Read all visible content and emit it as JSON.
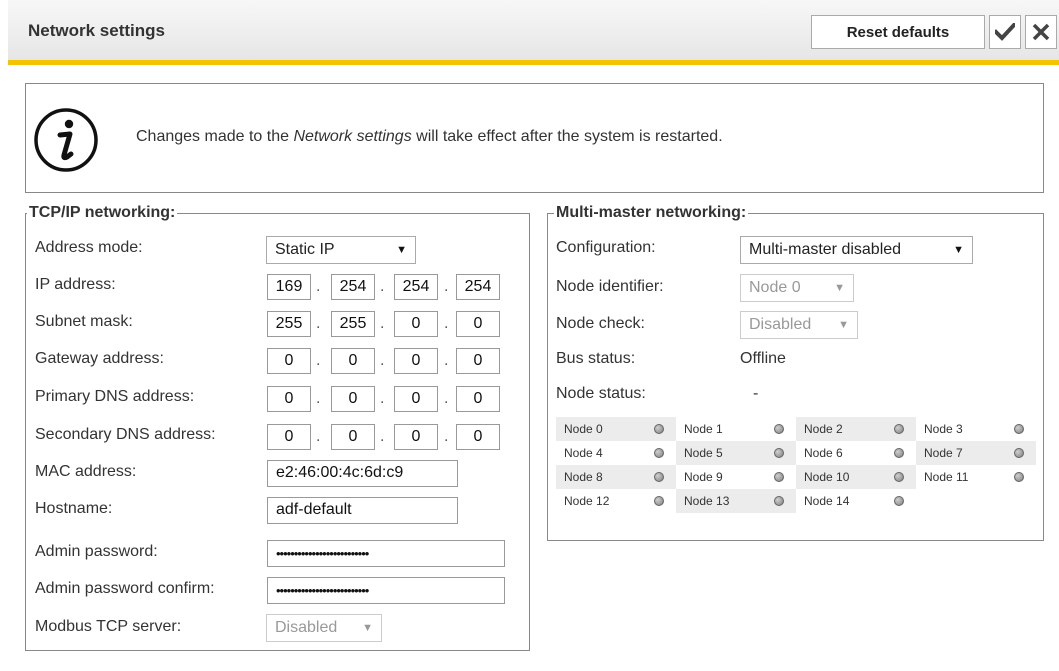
{
  "header": {
    "title": "Network settings",
    "reset_label": "Reset defaults",
    "ok_icon": "check-icon",
    "close_icon": "close-icon",
    "accent_color": "#f5c400"
  },
  "notice": {
    "icon": "info-icon",
    "text_before": "Changes made to the ",
    "text_em": "Network settings",
    "text_after": " will take effect after the system is restarted."
  },
  "tcp": {
    "title": "TCP/IP networking:",
    "address_mode": {
      "label": "Address mode:",
      "value": "Static IP"
    },
    "ip_address": {
      "label": "IP address:",
      "octets": [
        "169",
        "254",
        "254",
        "254"
      ]
    },
    "subnet_mask": {
      "label": "Subnet mask:",
      "octets": [
        "255",
        "255",
        "0",
        "0"
      ]
    },
    "gateway": {
      "label": "Gateway address:",
      "octets": [
        "0",
        "0",
        "0",
        "0"
      ]
    },
    "primary_dns": {
      "label": "Primary DNS address:",
      "octets": [
        "0",
        "0",
        "0",
        "0"
      ]
    },
    "secondary_dns": {
      "label": "Secondary DNS address:",
      "octets": [
        "0",
        "0",
        "0",
        "0"
      ]
    },
    "mac": {
      "label": "MAC address:",
      "value": "e2:46:00:4c:6d:c9"
    },
    "hostname": {
      "label": "Hostname:",
      "value": "adf-default"
    },
    "admin_password": {
      "label": "Admin password:",
      "value": "••••••••••••••••••••••••••"
    },
    "admin_password_confirm": {
      "label": "Admin password confirm:",
      "value": "••••••••••••••••••••••••••"
    },
    "modbus": {
      "label": "Modbus TCP server:",
      "value": "Disabled"
    }
  },
  "mm": {
    "title": "Multi-master networking:",
    "configuration": {
      "label": "Configuration:",
      "value": "Multi-master disabled"
    },
    "node_identifier": {
      "label": "Node identifier:",
      "value": "Node 0"
    },
    "node_check": {
      "label": "Node check:",
      "value": "Disabled"
    },
    "bus_status": {
      "label": "Bus status:",
      "value": "Offline"
    },
    "node_status": {
      "label": "Node status:",
      "value": "-"
    },
    "nodes": [
      "Node 0",
      "Node 1",
      "Node 2",
      "Node 3",
      "Node 4",
      "Node 5",
      "Node 6",
      "Node 7",
      "Node 8",
      "Node 9",
      "Node 10",
      "Node 11",
      "Node 12",
      "Node 13",
      "Node 14"
    ]
  }
}
